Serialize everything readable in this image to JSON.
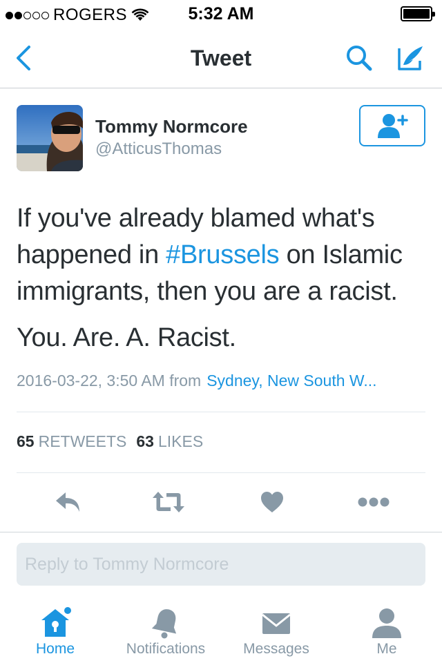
{
  "status_bar": {
    "carrier": "ROGERS",
    "time": "5:32 AM",
    "signal_bars_filled": 2,
    "signal_bars_total": 5
  },
  "nav": {
    "title": "Tweet",
    "back_icon": "chevron-left-icon",
    "search_icon": "search-icon",
    "compose_icon": "compose-icon"
  },
  "tweet": {
    "author_name": "Tommy Normcore",
    "author_handle": "@AtticusThomas",
    "text_line1_before": "If you've already blamed what's happened in ",
    "hashtag": "#Brussels",
    "text_line1_after": " on Islamic immigrants, then you are a racist.",
    "text_line2": "You. Are. A. Racist.",
    "timestamp": "2016-03-22, 3:50 AM from",
    "location": "Sydney, New South W...",
    "retweets_count": "65",
    "retweets_label": "RETWEETS",
    "likes_count": "63",
    "likes_label": "LIKES"
  },
  "reply": {
    "placeholder": "Reply to Tommy Normcore"
  },
  "tabs": [
    {
      "label": "Home",
      "icon": "home-icon",
      "active": true
    },
    {
      "label": "Notifications",
      "icon": "bell-icon",
      "active": false
    },
    {
      "label": "Messages",
      "icon": "envelope-icon",
      "active": false
    },
    {
      "label": "Me",
      "icon": "person-icon",
      "active": false
    }
  ],
  "colors": {
    "accent": "#1b95e0",
    "text": "#292f33",
    "muted": "#8899a6",
    "action_icon": "#8899a6"
  }
}
